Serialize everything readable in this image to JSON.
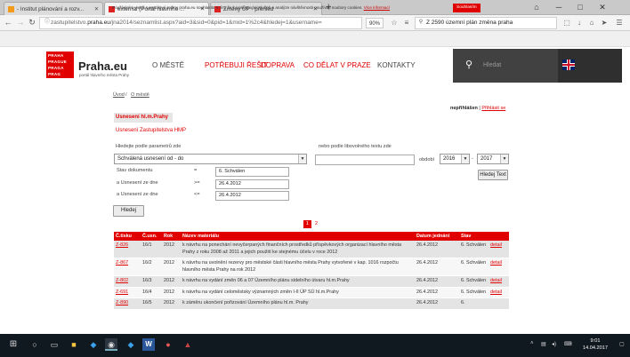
{
  "browser": {
    "tabs": [
      {
        "title": "- Institut plánování a rozv...",
        "icon": "ipr-favicon",
        "active": false
      },
      {
        "title": "external (Portál hlavního ...",
        "icon": "praha-favicon",
        "active": true
      },
      {
        "title": "Změny ÚP - přehled",
        "icon": "praha-favicon",
        "active": false
      }
    ],
    "new_tab": "+",
    "url_prefix": "zastupitelstvo.",
    "url_domain": "praha.eu",
    "url_rest": "/jna2014/seznamlist.aspx?aid=3&sid=0&pid=1&mid=1%2c4&hledej=1&username=",
    "zoom": "90%",
    "search_value": "Z 2590 územní plán změna praha"
  },
  "cookie_bar": {
    "text": "Používáním webů s portálové rodiny praha.eu souhlasíte s tím, že k poskytování služeb a analýze návštěvnosti používají soubory cookies.",
    "link": "Více informací",
    "button": "Souhlasím"
  },
  "header": {
    "logo_lines": [
      "PRAHA",
      "PRAGUE",
      "PRAGA",
      "PRAG"
    ],
    "brand": "Praha.eu",
    "brand_sub": "portál hlavního města Prahy",
    "nav": [
      "O MĚSTĚ",
      "POTŘEBUJI ŘEŠIT",
      "DOPRAVA",
      "CO DĚLAT V PRAZE",
      "KONTAKTY"
    ],
    "search_placeholder": "Hledat"
  },
  "breadcrumb": [
    "Úvod",
    "O městě"
  ],
  "login": {
    "status": "nepřihlášen",
    "separator": "|",
    "link": "Přihlásit se"
  },
  "section": {
    "tab": "Usnesení hl.m.Prahy",
    "sublink": "Usnesení Zastupitelstva HMP"
  },
  "filter": {
    "param_label": "Hledejte podle parametrů zde",
    "param_select": "Schválená usnesení od - do",
    "text_label": "nebo podle libovolného textu zde",
    "period_label": "období",
    "year_from": "2016",
    "dash": "-",
    "year_to": "2017",
    "text_button": "Hledej Text",
    "rows": [
      {
        "label": "Stav dokumentu",
        "op": "=",
        "value": "6. Schválen"
      },
      {
        "label": "a Usnesení ze dne",
        "op": ">=",
        "value": "26.4.2012"
      },
      {
        "label": "a Usnesení ze dne",
        "op": "<=",
        "value": "26.4.2012"
      }
    ],
    "search_button": "Hledej"
  },
  "pagination": {
    "current": "1",
    "next": "2"
  },
  "table": {
    "headers": [
      "Č.tisku",
      "Č.usn.",
      "Rok",
      "Název materiálu",
      "Datum jednání",
      "Stav",
      ""
    ],
    "rows": [
      {
        "tisk": "Z-826",
        "usn": "16/1",
        "rok": "2012",
        "nazev": "k návrhu na ponechání nevyčerpaných finančních prostředků příspěvkových organizací hlavního města Prahy z roku 2008 až 2011 a jejich použití ke stejnému účelu v roce 2012",
        "datum": "26.4.2012",
        "stav": "6. Schválen",
        "detail": "detail"
      },
      {
        "tisk": "Z-867",
        "usn": "16/2",
        "rok": "2012",
        "nazev": "k návrhu na uvolnění rezervy pro městské části hlavního města Prahy vytvořené v kap. 1016 rozpočtu hlavního města Prahy na rok 2012",
        "datum": "26.4.2012",
        "stav": "6. Schválen",
        "detail": "detail"
      },
      {
        "tisk": "Z-802",
        "usn": "16/3",
        "rok": "2012",
        "nazev": "k návrhu na vydání změn 06 a 07 Územního plánu sídelního útvaru hl.m.Prahy",
        "datum": "26.4.2012",
        "stav": "6. Schválen",
        "detail": "detail"
      },
      {
        "tisk": "Z-691",
        "usn": "16/4",
        "rok": "2012",
        "nazev": "k návrhu na vydání celoměstsky významných změn I-II ÚP SÚ hl.m.Prahy",
        "datum": "26.4.2012",
        "stav": "6. Schválen",
        "detail": "detail"
      },
      {
        "tisk": "Z-890",
        "usn": "16/5",
        "rok": "2012",
        "nazev": "k záměru ukončení pořizování Územního plánu hl.m. Prahy",
        "datum": "26.4.2012",
        "stav": "6.",
        "detail": ""
      }
    ]
  },
  "taskbar": {
    "time": "9:01",
    "date": "14.04.2017"
  },
  "colors": {
    "accent": "#e10000",
    "dark": "#414141",
    "taskbar": "#101820"
  }
}
